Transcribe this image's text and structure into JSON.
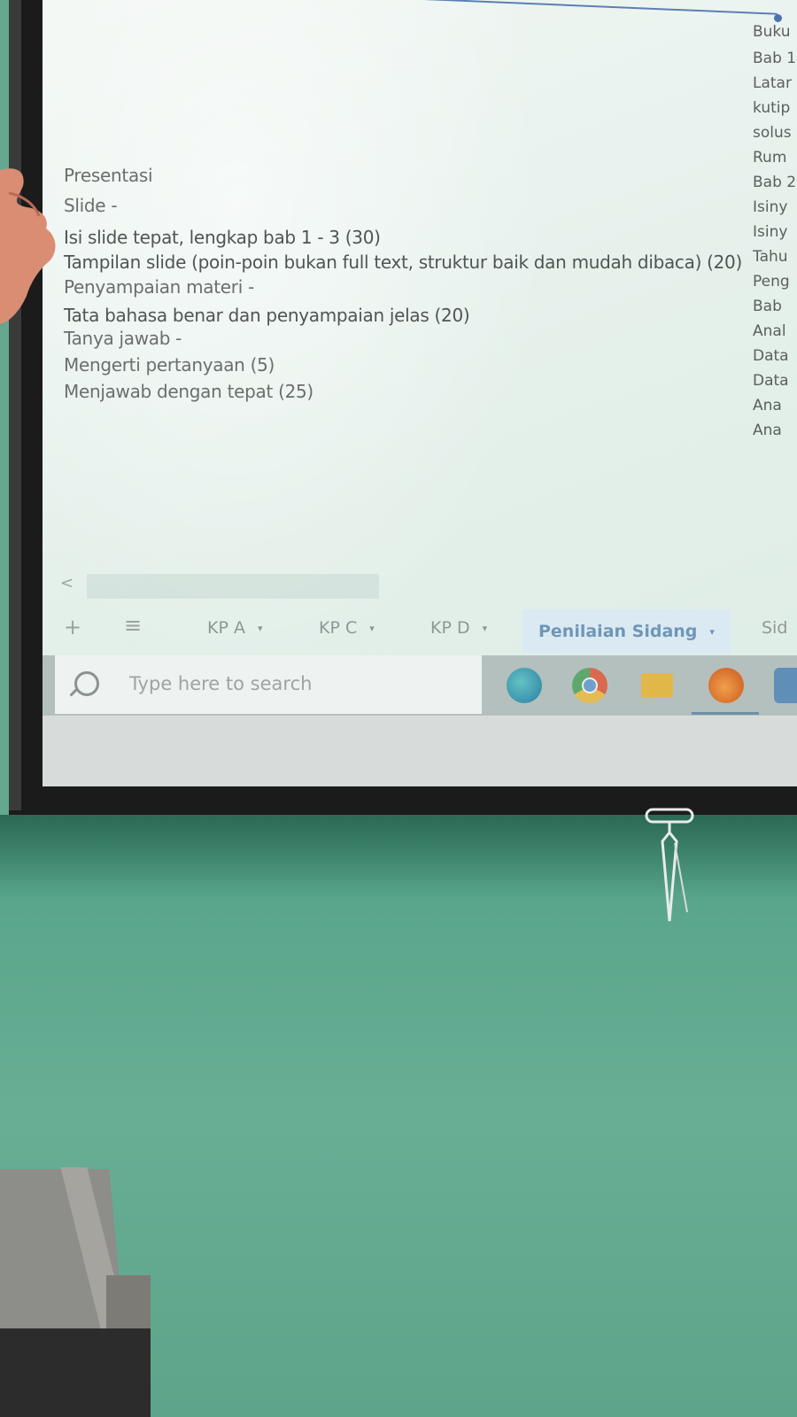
{
  "spreadsheet": {
    "rubric_lines": [
      "Presentasi",
      "Slide -",
      "Isi slide tepat, lengkap bab 1 - 3 (30)",
      "Tampilan slide (poin-poin bukan full text, struktur baik dan mudah dibaca)  (20)",
      "Penyampaian materi -",
      "Tata bahasa benar dan penyampaian jelas (20)",
      "Tanya jawab -",
      "Mengerti pertanyaan (5)",
      "Menjawab dengan tepat (25)"
    ],
    "right_column": [
      "Buku",
      "Bab 1",
      "Latar",
      "kutip",
      "solus",
      "Rum",
      "Bab 2",
      "Isiny",
      "Isiny",
      "Tahu",
      "Peng",
      "Bab",
      "Anal",
      "Data",
      "Data",
      "Ana",
      "Ana"
    ],
    "scroll_left_arrow": "<"
  },
  "sheet_tabs": {
    "add_label": "+",
    "menu_label": "≡",
    "tabs": [
      {
        "label": "KP A",
        "caret": "▾"
      },
      {
        "label": "KP C",
        "caret": "▾"
      },
      {
        "label": "KP D",
        "caret": "▾"
      },
      {
        "label": "Penilaian Sidang",
        "caret": "▾",
        "active": true
      },
      {
        "label": "Sid"
      }
    ]
  },
  "taskbar": {
    "search_placeholder": "Type here to search",
    "pinned_apps": [
      "edge-icon",
      "chrome-icon",
      "folder-icon",
      "firefox-icon",
      "app-icon"
    ]
  },
  "colors": {
    "active_tab": "#6f96b7",
    "wall": "#63a88f"
  }
}
